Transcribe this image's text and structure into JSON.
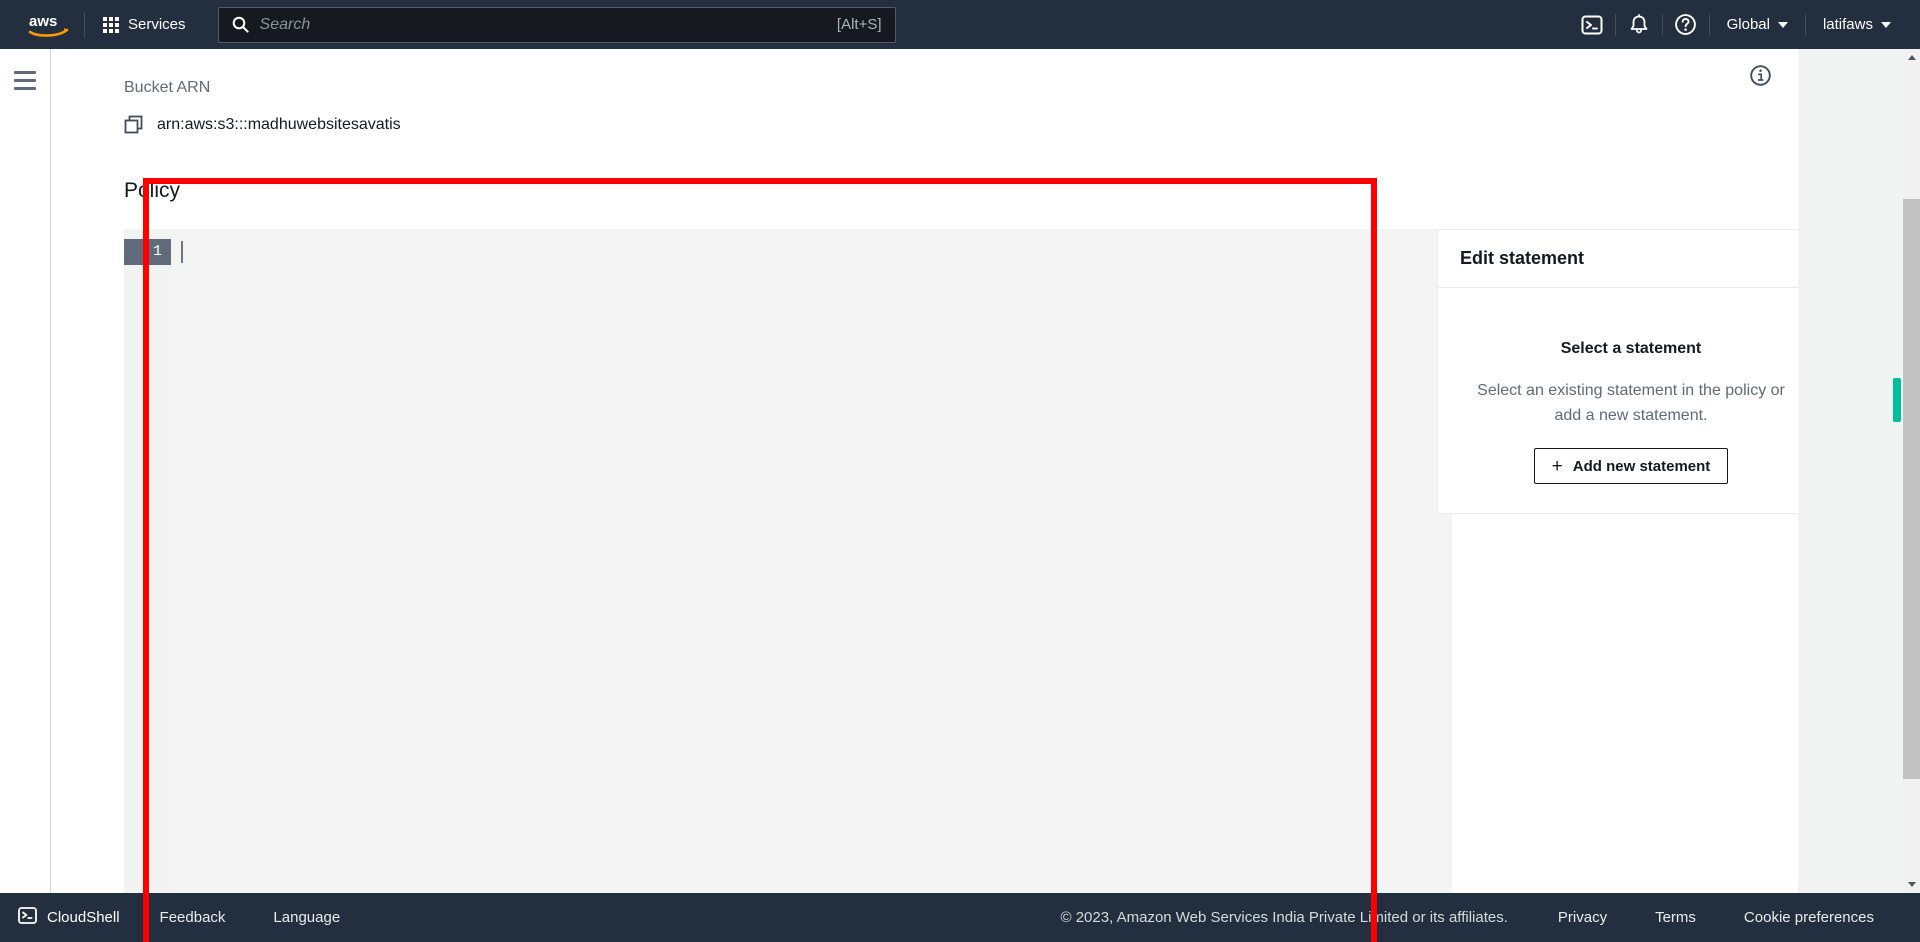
{
  "topnav": {
    "logo_alt": "aws-logo",
    "services_label": "Services",
    "search": {
      "placeholder": "Search",
      "shortcut": "[Alt+S]"
    },
    "cloudshell_icon": "cloudshell-icon",
    "notifications_icon": "bell-icon",
    "help_icon": "help-circle-icon",
    "region_label": "Global",
    "account_label": "latifaws"
  },
  "sidebar": {
    "menu_icon": "hamburger-menu-icon"
  },
  "main": {
    "info_icon": "info-circle-icon",
    "bucket_arn_label": "Bucket ARN",
    "bucket_arn_value": "arn:aws:s3:::madhuwebsitesavatis",
    "copy_icon": "copy-icon",
    "policy_heading": "Policy",
    "editor": {
      "line_numbers": [
        "1"
      ],
      "content": ""
    }
  },
  "side_panel": {
    "title": "Edit statement",
    "empty_title": "Select a statement",
    "empty_description": "Select an existing statement in the policy or add a new statement.",
    "add_button_label": "Add new statement",
    "add_button_icon": "plus-icon"
  },
  "annotation": {
    "color": "#fe0000"
  },
  "scrollbar": {
    "up_icon": "scroll-up-arrow-icon",
    "down_icon": "scroll-down-arrow-icon",
    "marker_color": "#00bf9a"
  },
  "footer": {
    "cloudshell_label": "CloudShell",
    "cloudshell_icon": "cloudshell-icon",
    "feedback_label": "Feedback",
    "language_label": "Language",
    "copyright": "© 2023, Amazon Web Services India Private Limited or its affiliates.",
    "privacy_label": "Privacy",
    "terms_label": "Terms",
    "cookie_label": "Cookie preferences",
    "expand_icon": "chevron-down-icon"
  }
}
